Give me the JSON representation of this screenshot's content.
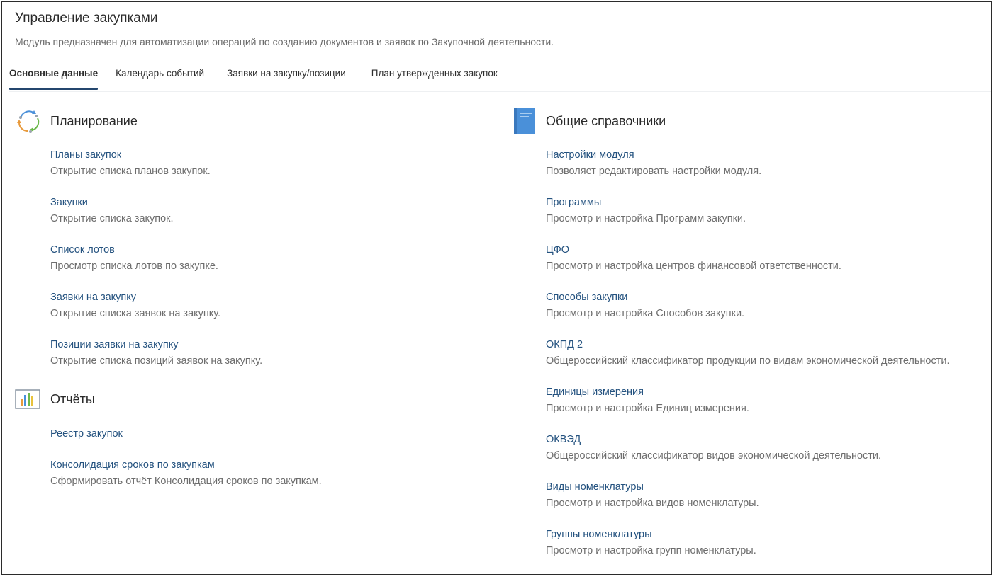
{
  "header": {
    "title": "Управление закупками",
    "description": "Модуль предназначен для автоматизации операций по созданию документов и заявок по Закупочной деятельности."
  },
  "tabs": [
    {
      "label": "Основные данные",
      "active": true
    },
    {
      "label": "Календарь событий",
      "active": false
    },
    {
      "label": "Заявки на закупку/позиции",
      "active": false
    },
    {
      "label": "План утвержденных закупок",
      "active": false
    }
  ],
  "planning": {
    "title": "Планирование",
    "icon": "cycle-arrows-icon",
    "items": [
      {
        "label": "Планы закупок",
        "desc": "Открытие списка планов закупок."
      },
      {
        "label": "Закупки",
        "desc": "Открытие списка закупок."
      },
      {
        "label": "Список лотов",
        "desc": "Просмотр списка лотов по закупке."
      },
      {
        "label": "Заявки на закупку",
        "desc": "Открытие списка заявок на закупку."
      },
      {
        "label": "Позиции заявки на закупку",
        "desc": "Открытие списка позиций заявок на закупку."
      }
    ]
  },
  "reports": {
    "title": "Отчёты",
    "icon": "bar-chart-icon",
    "items": [
      {
        "label": "Реестр закупок",
        "desc": ""
      },
      {
        "label": "Консолидация сроков по закупкам",
        "desc": "Сформировать отчёт Консолидация сроков по закупкам."
      }
    ]
  },
  "references": {
    "title": "Общие справочники",
    "icon": "book-icon",
    "items": [
      {
        "label": "Настройки модуля",
        "desc": "Позволяет редактировать настройки модуля."
      },
      {
        "label": "Программы",
        "desc": "Просмотр и настройка Программ закупки."
      },
      {
        "label": "ЦФО",
        "desc": "Просмотр и настройка центров финансовой ответственности."
      },
      {
        "label": "Способы закупки",
        "desc": "Просмотр и настройка Способов закупки."
      },
      {
        "label": "ОКПД 2",
        "desc": "Общероссийский классификатор продукции по видам экономической деятельности."
      },
      {
        "label": "Единицы измерения",
        "desc": "Просмотр и настройка Единиц измерения."
      },
      {
        "label": "ОКВЭД",
        "desc": "Общероссийский классификатор видов экономической деятельности."
      },
      {
        "label": "Виды номенклатуры",
        "desc": "Просмотр и настройка видов номенклатуры."
      },
      {
        "label": "Группы номенклатуры",
        "desc": "Просмотр и настройка групп номенклатуры."
      }
    ]
  },
  "colors": {
    "link": "#24527f",
    "tab_indicator": "#24466e",
    "book_icon": "#4a90d9"
  }
}
